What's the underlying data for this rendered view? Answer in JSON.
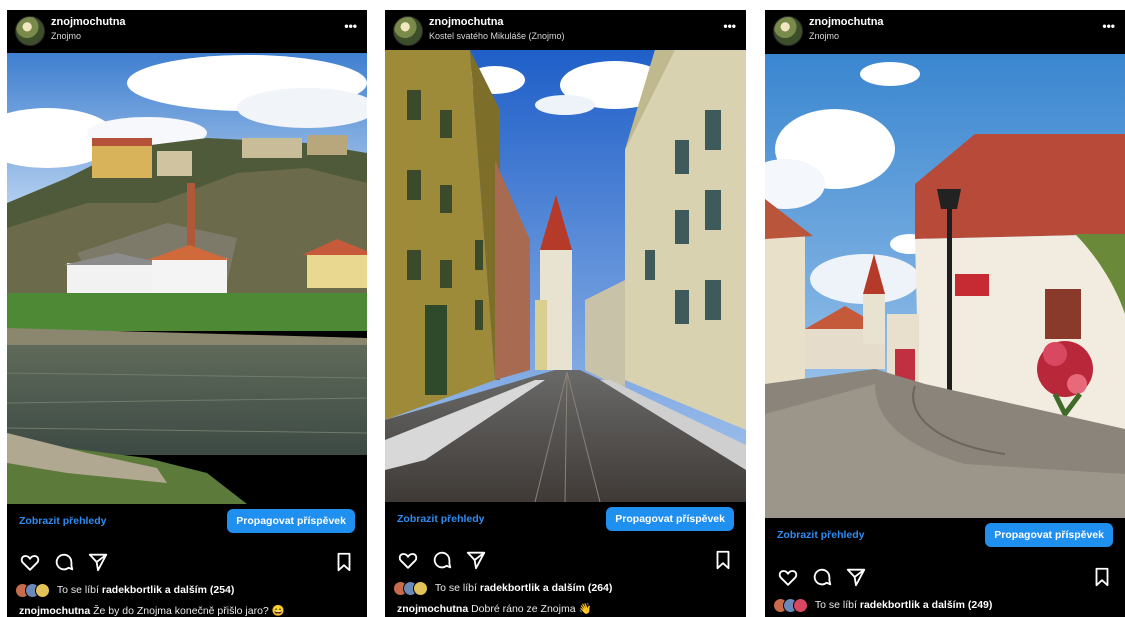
{
  "posts": [
    {
      "username": "znojmochutna",
      "location": "Znojmo",
      "insights_label": "Zobrazit přehledy",
      "promote_label": "Propagovat příspěvek",
      "likes_prefix": "To se líbí",
      "likes_user": "radekbortlik",
      "likes_middle": "a",
      "likes_others": "dalším (254)",
      "caption_user": "znojmochutna",
      "caption_text": "Že by do Znojma konečně přišlo jaro? 😄"
    },
    {
      "username": "znojmochutna",
      "location": "Kostel svatého Mikuláše (Znojmo)",
      "insights_label": "Zobrazit přehledy",
      "promote_label": "Propagovat příspěvek",
      "likes_prefix": "To se líbí",
      "likes_user": "radekbortlik",
      "likes_middle": "a",
      "likes_others": "dalším (264)",
      "caption_user": "znojmochutna",
      "caption_text": "Dobré ráno ze Znojma 👋"
    },
    {
      "username": "znojmochutna",
      "location": "Znojmo",
      "insights_label": "Zobrazit přehledy",
      "promote_label": "Propagovat příspěvek",
      "likes_prefix": "To se líbí",
      "likes_user": "radekbortlik",
      "likes_middle": "a",
      "likes_others": "dalším (249)"
    }
  ],
  "icons": {
    "more": "more-icon",
    "like": "heart-icon",
    "comment": "comment-icon",
    "share": "share-icon",
    "save": "bookmark-icon"
  },
  "colors": {
    "background": "#000000",
    "accent": "#1f8ff0",
    "link": "#2f8cf0"
  },
  "more_symbol": "•••"
}
